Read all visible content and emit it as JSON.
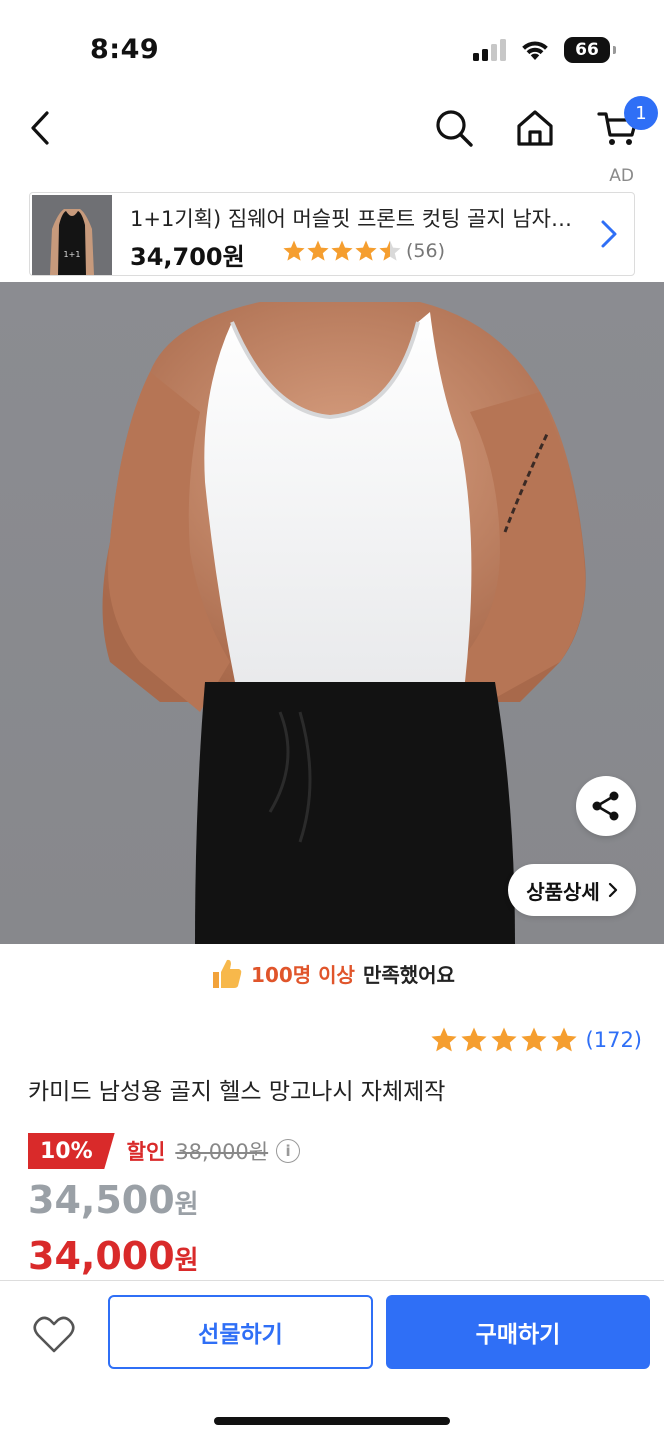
{
  "status_bar": {
    "time": "8:49",
    "battery": "66"
  },
  "header": {
    "cart_count": "1"
  },
  "ad": {
    "label": "AD",
    "title": "1+1기획) 짐웨어 머슬핏 프론트 컷팅 골지 남자…",
    "price": "34,700원",
    "rating": 4.5,
    "review_count": "(56)"
  },
  "product": {
    "satisfaction_highlight": "100명 이상",
    "satisfaction_rest": "만족했어요",
    "rating": 5,
    "review_count": "(172)",
    "title": "카미드 남성용 골지 헬스 망고나시 자체제작",
    "discount_rate": "10%",
    "discount_word": "할인",
    "original_price": "38,000원",
    "sale_price": "34,500",
    "final_price": "34,000",
    "currency_unit": "원",
    "detail_button": "상품상세"
  },
  "bottom_bar": {
    "gift_label": "선물하기",
    "buy_label": "구매하기"
  },
  "colors": {
    "accent": "#2f6ff6",
    "sale_red": "#d92a2a",
    "star": "#f59e2f"
  }
}
